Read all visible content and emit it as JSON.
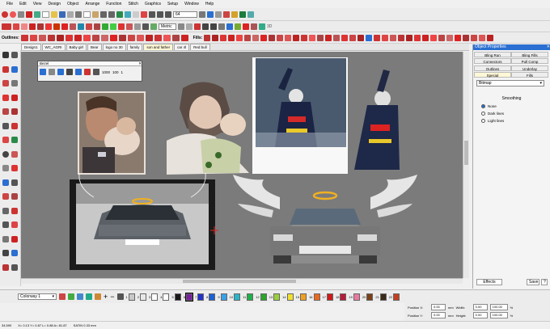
{
  "menubar": [
    "File",
    "Edit",
    "View",
    "Design",
    "Object",
    "Arrange",
    "Function",
    "Stitch",
    "Graphics",
    "Setup",
    "Window",
    "Help"
  ],
  "toolbar": {
    "zoom_value": "64",
    "units_value": "Metric",
    "outlines_label": "Outlines:",
    "fills_label": "Fills:",
    "three_d": "3D"
  },
  "tabs": [
    "Design1",
    "WC_AGRI",
    "Baby girl",
    "Bear",
    "logo no 30",
    "family",
    "son and father",
    "car 4l",
    "Red bull"
  ],
  "active_tab_index": 6,
  "floating_palette": {
    "title": "Bezel",
    "labels": [
      "1000",
      "100",
      "1"
    ]
  },
  "panel": {
    "title": "Object Properties",
    "tabs": [
      "Bling Run",
      "Bling Fills",
      "Connectors",
      "Pull Comp",
      "Outlines",
      "Underlay",
      "Special",
      "Fills"
    ],
    "dropdown_value": "Bitmap",
    "smoothing_label": "Smoothing",
    "options": [
      {
        "label": "None",
        "checked": true
      },
      {
        "label": "Dark lines",
        "checked": false
      },
      {
        "label": "Light lines",
        "checked": false
      }
    ],
    "effects_button": "Effects",
    "save_button": "Save",
    "help_button": "?"
  },
  "colorbar": {
    "colorway": "Colorway 1",
    "swatches": [
      {
        "n": "1",
        "c": "#c8c8c8"
      },
      {
        "n": "2",
        "c": "#e8e8e8"
      },
      {
        "n": "3",
        "c": "#ffffff"
      },
      {
        "n": "4",
        "c": "#ffffff"
      },
      {
        "n": "5",
        "c": "#1a1a1a"
      },
      {
        "n": "6",
        "c": "#7a1fa2"
      },
      {
        "n": "7",
        "c": "#2233cc"
      },
      {
        "n": "8",
        "c": "#1d5fd6"
      },
      {
        "n": "9",
        "c": "#3aa0e8"
      },
      {
        "n": "10",
        "c": "#2bb5c9"
      },
      {
        "n": "11",
        "c": "#1fb04a"
      },
      {
        "n": "12",
        "c": "#2aa52a"
      },
      {
        "n": "13",
        "c": "#9ad03a"
      },
      {
        "n": "14",
        "c": "#f0e030"
      },
      {
        "n": "15",
        "c": "#f0a020"
      },
      {
        "n": "16",
        "c": "#e86a20"
      },
      {
        "n": "17",
        "c": "#d01818"
      },
      {
        "n": "18",
        "c": "#b81a3a"
      },
      {
        "n": "19",
        "c": "#e87aa0"
      },
      {
        "n": "20",
        "c": "#7a4018"
      },
      {
        "n": "21",
        "c": "#3a2a1a"
      },
      {
        "n": "22",
        "c": "#c04020"
      }
    ],
    "active_swatch": "6"
  },
  "position": {
    "x_label": "Position X:",
    "y_label": "Position Y:",
    "w_label": "Width:",
    "h_label": "Height:",
    "x": "0.00",
    "y": "0.00",
    "x_unit": "mm",
    "y_unit": "mm",
    "w": "0.00",
    "h": "0.00",
    "w_pct": "100.00",
    "h_pct": "100.00",
    "pct": "%"
  },
  "status": {
    "coords": "34,590",
    "x": "X= 0.13 Y= 0.87 L= 0.88 A= 81.87",
    "satin": "SATIN 0.33 mm"
  }
}
